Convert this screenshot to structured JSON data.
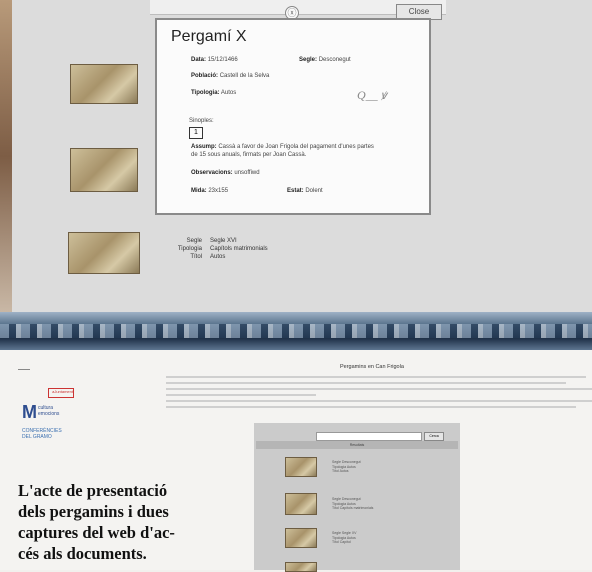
{
  "top_dialog": {
    "close_icon": "ⓧ",
    "close_label": "Close",
    "title": "Pergamí X",
    "fields": {
      "data_label": "Data:",
      "data_value": "15/12/1466",
      "segle_label": "Segle:",
      "segle_value": "Desconegut",
      "poblacio_label": "Població:",
      "poblacio_value": "Castell de la Selva",
      "tipologia_label": "Tipologia:",
      "tipologia_value": "Autos",
      "signature": "Q__ ꝟ",
      "sinoples_label": "Sinoples:",
      "sinoples_value": "1",
      "assump_label": "Assump:",
      "assump_line1": "Cassà a favor de Joan Frigola del pagament d'unes partes",
      "assump_line2": "de 15 sous anuals, firmats per Joan Cassà.",
      "obs_label": "Observacions:",
      "obs_value": "unsoffiwd",
      "mida_label": "Mida:",
      "mida_value": "23x155",
      "estat_label": "Estat:",
      "estat_value": "Dolent"
    },
    "third_record": {
      "segle_label": "Segle",
      "segle_value": "Segle XVI",
      "tipologia_label": "Tipologia",
      "tipologia_value": "Capítols matrimonials",
      "titol_label": "Títol",
      "titol_value": "Autos"
    }
  },
  "lower_page": {
    "title": "Pergamins en Can Frigola",
    "logo_small": "aJuntament",
    "m_logo": "M",
    "m_sub1": "cultura",
    "m_sub2": "emocions",
    "blue1": "CONFERÈNCIES",
    "blue2": "DEL GRAMO",
    "search_button": "Cerca",
    "results_band": "Resultats",
    "results": [
      {
        "l1": "Segle  Desconegut",
        "l2": "Tipologia  Autos",
        "l3": "Títol  Autos"
      },
      {
        "l1": "Segle  Desconegut",
        "l2": "Tipologia  Autos",
        "l3": "Títol  Capítols matrimonials"
      },
      {
        "l1": "Segle  Segle XV",
        "l2": "Tipologia  Autos",
        "l3": "Títol  Capítol"
      }
    ]
  },
  "caption": {
    "line1": "L'acte de presentació",
    "line2": "dels pergamins i dues",
    "line3": "captures del web d'ac-",
    "line4": "cés als documents."
  }
}
